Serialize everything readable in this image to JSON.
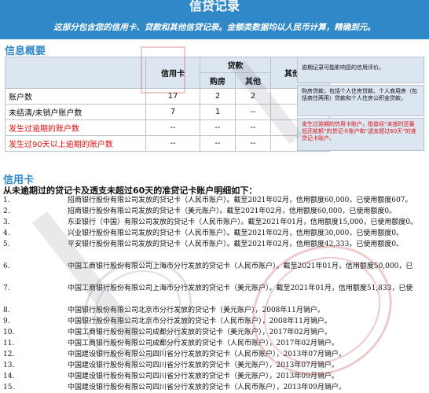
{
  "banner": {
    "title": "信贷记录",
    "note": "这部分包含您的信用卡、贷款和其他信贷记录。金额类数据均以人民币计算，精确到元。"
  },
  "summary": {
    "section_title": "信息概要",
    "headers": {
      "credit_card": "信用卡",
      "loan": "贷款",
      "housing": "购房",
      "other": "其他",
      "other_business": "其他业务"
    },
    "rows": [
      {
        "label": "账户数",
        "card": "17",
        "housing": "2",
        "other": "2",
        "business": "--",
        "red": false
      },
      {
        "label": "未结清/未销户账户数",
        "card": "7",
        "housing": "1",
        "other": "--",
        "business": "--",
        "red": false
      },
      {
        "label": "发生过逾期的账户数",
        "card": "--",
        "housing": "--",
        "other": "--",
        "business": "--",
        "red": true
      },
      {
        "label": "发生过90天以上逾期的账户数",
        "card": "--",
        "housing": "--",
        "other": "--",
        "business": "--",
        "red": true
      }
    ]
  },
  "notes": [
    {
      "text": "逾期记录可能影响您的信用评价。",
      "red": false
    },
    {
      "text": "购房贷款，包括个人住房贷款、个人商用房（包括商住两用）贷款和个人住房公积金贷款。",
      "red": false
    },
    {
      "text": "发生过逾期的信用卡账户，指曾经“未按时还最低还款额”的贷记卡账户和“透支超过60天”的准贷记卡账户。",
      "red": true
    }
  ],
  "credit_cards": {
    "section_title": "信用卡",
    "subtitle": "从未逾期过的贷记卡及透支未超过60天的准贷记卡账户明细如下：",
    "items": [
      {
        "num": "1.",
        "text": "招商银行股份有限公司发放的贷记卡（人民币账户）。截至2021年02月，信用额度60,000，已使用额度607。"
      },
      {
        "num": "2.",
        "text": "招商银行股份有限公司发放的贷记卡（美元账户）。截至2021年02月，信用额度60,000，已使用额度0。"
      },
      {
        "num": "3.",
        "text": "东亚银行（中国）有限公司发放的贷记卡（人民币账户）。截至2021年01月，信用额度15,000，已使用额度0。"
      },
      {
        "num": "4.",
        "text": "兴业银行股份有限公司发放的贷记卡（人民币账户）。截至2021年02月，信用额度30,000，已使用额度0。"
      },
      {
        "num": "5.",
        "text": "平安银行股份有限公司发放的贷记卡（人民币账户）。截至2021年02月，信用额度42,333，已使用额度0。"
      },
      {
        "num": "6.",
        "text": "中国工商银行股份有限公司上海市分行发放的贷记卡（人民币账户）。截至2021年01月，信用额度50,000，已"
      },
      {
        "num": "7.",
        "text": "中国工商银行股份有限公司上海市分行发放的贷记卡（美元账户）。截至2021年01月，信用额度51,833，已使"
      },
      {
        "num": "8.",
        "text": "中国银行股份有限公司北京市分行发放的贷记卡（美元账户），2008年11月销户。"
      },
      {
        "num": "9.",
        "text": "中国银行股份有限公司北京市分行发放的贷记卡（人民币账户），2008年11月销户。"
      },
      {
        "num": "10.",
        "text": "中国工商银行股份有限公司成都分行发放的贷记卡（美元账户），2017年02月销户。"
      },
      {
        "num": "11.",
        "text": "中国工商银行股份有限公司成都分行发放的贷记卡（人民币账户），2017年02月销户。"
      },
      {
        "num": "12.",
        "text": "中国建设银行股份有限公司四川省分行发放的贷记卡（人民币账户），2013年07月销户。"
      },
      {
        "num": "13.",
        "text": "中国建设银行股份有限公司四川省分行发放的贷记卡（美元账户），2013年07月销户。"
      },
      {
        "num": "14.",
        "text": "中国建设银行股份有限公司四川省分行发放的贷记卡（美元账户），2013年09月销户。"
      },
      {
        "num": "15.",
        "text": "中国建设银行股份有限公司四川省分行发放的贷记卡（人民币账户），2013年09月销户。"
      }
    ]
  },
  "colors": {
    "banner": "#2f88c8",
    "section_title": "#2f88c8",
    "header_fill": "#dbe6f1",
    "warning_red": "#e01010"
  }
}
